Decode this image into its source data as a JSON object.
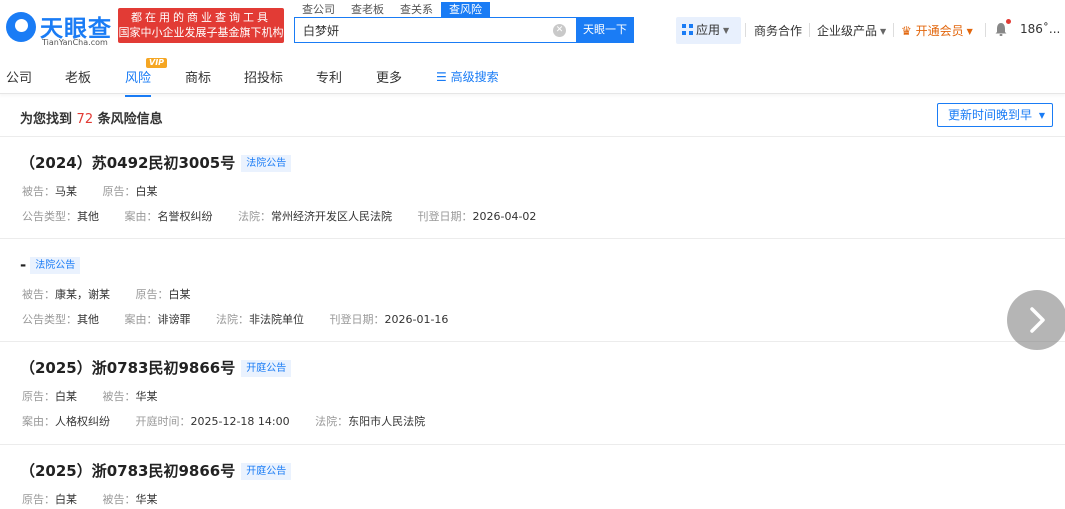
{
  "header": {
    "logo_name": "天眼查",
    "logo_url": "TianYanCha.com",
    "slogan_line1": "都在用的商业查询工具",
    "slogan_line2": "国家中小企业发展子基金旗下机构",
    "search_tabs": [
      "查公司",
      "查老板",
      "查关系",
      "查风险"
    ],
    "search_value": "白梦妍",
    "search_button": "天眼一下",
    "app_label": "应用",
    "business": "商务合作",
    "enterprise": "企业级产品",
    "vip": "开通会员",
    "user": "186˚..."
  },
  "nav": {
    "items": [
      "公司",
      "老板",
      "风险",
      "商标",
      "招投标",
      "专利",
      "更多"
    ],
    "vip_badge": "VIP",
    "advanced_search": "高级搜索"
  },
  "results": {
    "prefix": "为您找到",
    "count": "72",
    "suffix": "条风险信息",
    "sort_label": "更新时间晚到早"
  },
  "entries": [
    {
      "title": "（2024）苏0492民初3005号",
      "tag": "法院公告",
      "row1": [
        {
          "label": "被告：",
          "value": "马某"
        },
        {
          "label": "原告：",
          "value": "白某"
        }
      ],
      "row2": [
        {
          "label": "公告类型：",
          "value": "其他"
        },
        {
          "label": "案由：",
          "value": "名誉权纠纷"
        },
        {
          "label": "法院：",
          "value": "常州经济开发区人民法院"
        },
        {
          "label": "刊登日期：",
          "value": "2026-04-02"
        }
      ]
    },
    {
      "title": "-",
      "tag": "法院公告",
      "row1": [
        {
          "label": "被告：",
          "value": "康某，谢某"
        },
        {
          "label": "原告：",
          "value": "白某"
        }
      ],
      "row2": [
        {
          "label": "公告类型：",
          "value": "其他"
        },
        {
          "label": "案由：",
          "value": "诽谤罪"
        },
        {
          "label": "法院：",
          "value": "非法院单位"
        },
        {
          "label": "刊登日期：",
          "value": "2026-01-16"
        }
      ]
    },
    {
      "title": "（2025）浙0783民初9866号",
      "tag": "开庭公告",
      "row1": [
        {
          "label": "原告：",
          "value": "白某"
        },
        {
          "label": "被告：",
          "value": "华某"
        }
      ],
      "row2": [
        {
          "label": "案由：",
          "value": "人格权纠纷"
        },
        {
          "label": "开庭时间：",
          "value": "2025-12-18 14:00"
        },
        {
          "label": "法院：",
          "value": "东阳市人民法院"
        }
      ]
    },
    {
      "title": "（2025）浙0783民初9866号",
      "tag": "开庭公告",
      "row1": [
        {
          "label": "原告：",
          "value": "白某"
        },
        {
          "label": "被告：",
          "value": "华某"
        }
      ]
    }
  ],
  "icons": {
    "logo": "tianyancha-logo-icon",
    "clear": "clear-icon",
    "apps": "apps-grid-icon",
    "crown": "crown-icon",
    "bell": "bell-icon",
    "advanced": "filter-icon",
    "next": "chevron-right-icon"
  },
  "colors": {
    "brand": "#1a7cf5",
    "slogan_bg": "#e23b35",
    "count": "#e23b35",
    "vip": "#e2660c",
    "vip_badge": "#f5a623"
  }
}
